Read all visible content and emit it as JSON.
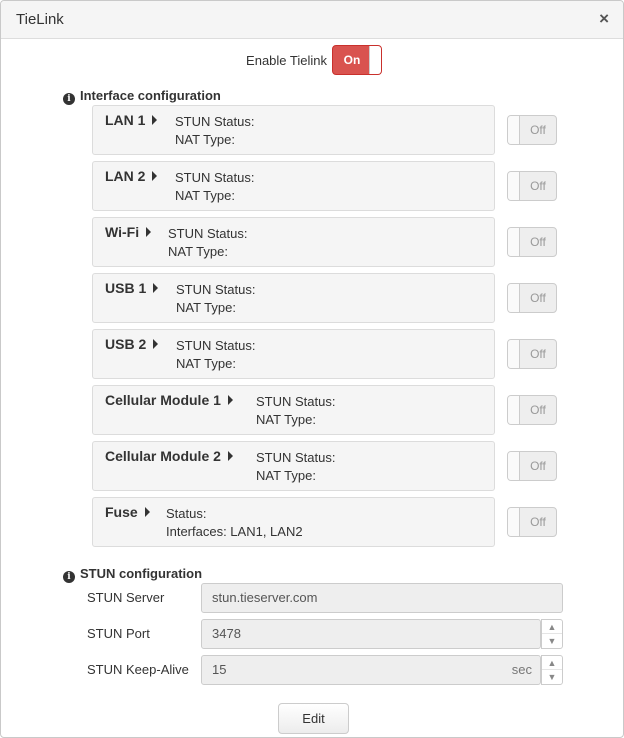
{
  "dialog": {
    "title": "TieLink",
    "close_glyph": "×"
  },
  "enable": {
    "label": "Enable Tielink",
    "toggle_text": "On",
    "state": "on"
  },
  "interface_section": {
    "title": "Interface configuration"
  },
  "interfaces": [
    {
      "name": "LAN 1",
      "line1": "STUN Status:",
      "line2": "NAT Type:",
      "toggle": "Off"
    },
    {
      "name": "LAN 2",
      "line1": "STUN Status:",
      "line2": "NAT Type:",
      "toggle": "Off"
    },
    {
      "name": "Wi-Fi",
      "line1": "STUN Status:",
      "line2": "NAT Type:",
      "toggle": "Off"
    },
    {
      "name": "USB 1",
      "line1": "STUN Status:",
      "line2": "NAT Type:",
      "toggle": "Off"
    },
    {
      "name": "USB 2",
      "line1": "STUN Status:",
      "line2": "NAT Type:",
      "toggle": "Off"
    },
    {
      "name": "Cellular Module 1",
      "line1": "STUN Status:",
      "line2": "NAT Type:",
      "toggle": "Off"
    },
    {
      "name": "Cellular Module 2",
      "line1": "STUN Status:",
      "line2": "NAT Type:",
      "toggle": "Off"
    },
    {
      "name": "Fuse",
      "line1": "Status:",
      "line2": "Interfaces: LAN1, LAN2",
      "toggle": "Off"
    }
  ],
  "stun_section": {
    "title": "STUN configuration",
    "server_label": "STUN Server",
    "server_value": "stun.tieserver.com",
    "port_label": "STUN Port",
    "port_value": "3478",
    "keepalive_label": "STUN Keep-Alive",
    "keepalive_value": "15",
    "keepalive_unit": "sec"
  },
  "footer": {
    "edit_label": "Edit"
  },
  "colors": {
    "toggle_on": "#d9534f",
    "panel_bg": "#f5f5f5",
    "input_bg": "#eeeeee"
  },
  "icons": {
    "info": "info-circle-icon",
    "close": "close-icon",
    "caret": "caret-right-icon"
  }
}
